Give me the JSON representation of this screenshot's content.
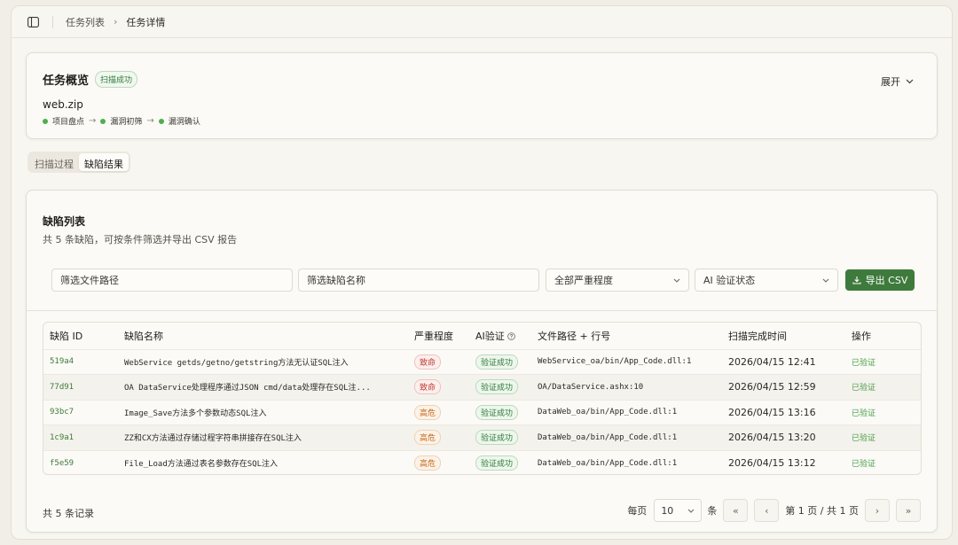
{
  "breadcrumb": [
    "任务列表",
    "任务详情"
  ],
  "overview": {
    "title": "任务概览",
    "status": "扫描成功",
    "expand_label": "展开",
    "filename": "web.zip",
    "stages": [
      "项目盘点",
      "漏洞初筛",
      "漏洞确认"
    ]
  },
  "tabs": [
    "扫描过程",
    "缺陷结果"
  ],
  "defects": {
    "title": "缺陷列表",
    "subtitle": "共 5 条缺陷，可按条件筛选并导出 CSV 报告",
    "filters": {
      "path_placeholder": "筛选文件路径",
      "name_placeholder": "筛选缺陷名称",
      "severity": "全部严重程度",
      "ai_status": "AI 验证状态"
    },
    "export_label": "导出 CSV",
    "columns": [
      "缺陷 ID",
      "缺陷名称",
      "严重程度",
      "AI验证",
      "文件路径 + 行号",
      "扫描完成时间",
      "操作"
    ],
    "rows": [
      {
        "id": "519a4",
        "name": "WebService getds/getno/getstring方法无认证SQL注入",
        "severity": "致命",
        "ai": "验证成功",
        "path": "WebService_oa/bin/App_Code.dll:1",
        "time": "2026/04/15 12:41",
        "action": "已验证"
      },
      {
        "id": "77d91",
        "name": "OA DataService处理程序通过JSON cmd/data处理存在SQL注...",
        "severity": "致命",
        "ai": "验证成功",
        "path": "OA/DataService.ashx:10",
        "time": "2026/04/15 12:59",
        "action": "已验证"
      },
      {
        "id": "93bc7",
        "name": "Image_Save方法多个参数动态SQL注入",
        "severity": "高危",
        "ai": "验证成功",
        "path": "DataWeb_oa/bin/App_Code.dll:1",
        "time": "2026/04/15 13:16",
        "action": "已验证"
      },
      {
        "id": "1c9a1",
        "name": "ZZ和CX方法通过存储过程字符串拼接存在SQL注入",
        "severity": "高危",
        "ai": "验证成功",
        "path": "DataWeb_oa/bin/App_Code.dll:1",
        "time": "2026/04/15 13:20",
        "action": "已验证"
      },
      {
        "id": "f5e59",
        "name": "File_Load方法通过表名参数存在SQL注入",
        "severity": "高危",
        "ai": "验证成功",
        "path": "DataWeb_oa/bin/App_Code.dll:1",
        "time": "2026/04/15 13:12",
        "action": "已验证"
      }
    ],
    "total_label": "共 5 条记录",
    "pager": {
      "per_page_label": "每页",
      "page_size": "10",
      "unit": "条",
      "page_info": "第 1 页 / 共 1 页"
    }
  },
  "colors": {
    "accent": "#3e7a3c",
    "critical": "#c03a34",
    "high": "#c46a1d",
    "success": "#2f7a3c"
  }
}
